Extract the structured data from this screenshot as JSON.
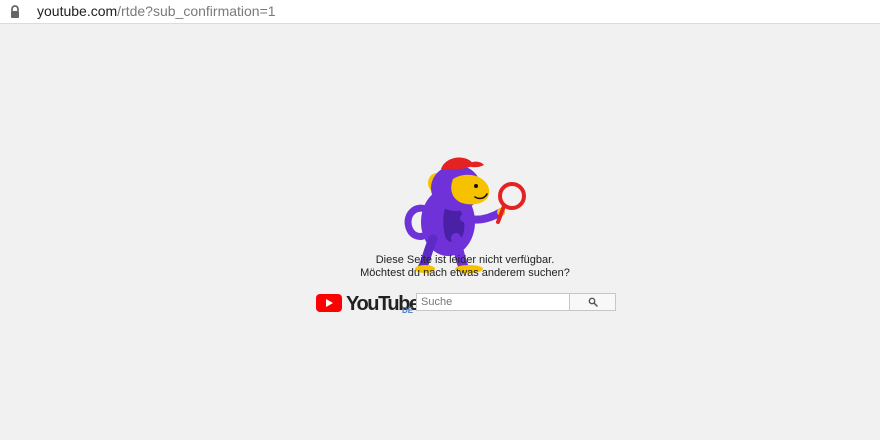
{
  "browser": {
    "url_host": "youtube.com",
    "url_rest": "/rtde?sub_confirmation=1"
  },
  "page": {
    "message_line_1": "Diese Seite ist leider nicht verfügbar.",
    "message_line_2": "Möchtest du nach etwas anderem suchen?",
    "logo_text": "YouTube",
    "country_code": "DE",
    "search_placeholder": "Suche"
  },
  "colors": {
    "page_background": "#f1f1f1",
    "youtube_red": "#ff0000",
    "monkey_purple": "#6f32d9",
    "monkey_yellow": "#f6c200",
    "accent_red": "#e52222"
  },
  "icons": {
    "lock": "lock-icon",
    "search": "search-icon",
    "illustration": "monkey-illustration"
  }
}
